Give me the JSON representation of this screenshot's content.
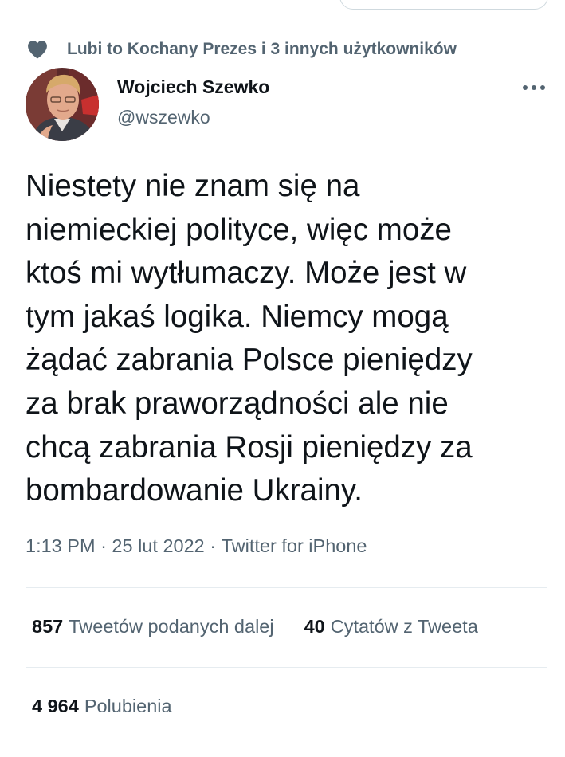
{
  "social_context": {
    "icon": "heart-icon",
    "text": "Lubi to Kochany Prezes i 3 innych użytkowników"
  },
  "author": {
    "name": "Wojciech Szewko",
    "handle": "@wszewko"
  },
  "tweet": {
    "text": "Niestety nie znam się na\nniemieckiej polityce, więc może\nktoś mi wytłumaczy. Może jest w\ntym jakaś logika. Niemcy mogą\nżądać zabrania Polsce pieniędzy\nza brak praworządności ale nie\nchcą zabrania Rosji pieniędzy za\nbombardowanie Ukrainy."
  },
  "meta": {
    "time": "1:13 PM",
    "separator": "·",
    "date": "25 lut 2022",
    "source": "Twitter for iPhone"
  },
  "stats": {
    "retweets_count": "857",
    "retweets_label": "Tweetów podanych dalej",
    "quotes_count": "40",
    "quotes_label": "Cytatów z Tweeta",
    "likes_count": "4 964",
    "likes_label": "Polubienia"
  },
  "colors": {
    "text_primary": "#0f1419",
    "text_secondary": "#536471",
    "divider": "#e6ecf0"
  }
}
